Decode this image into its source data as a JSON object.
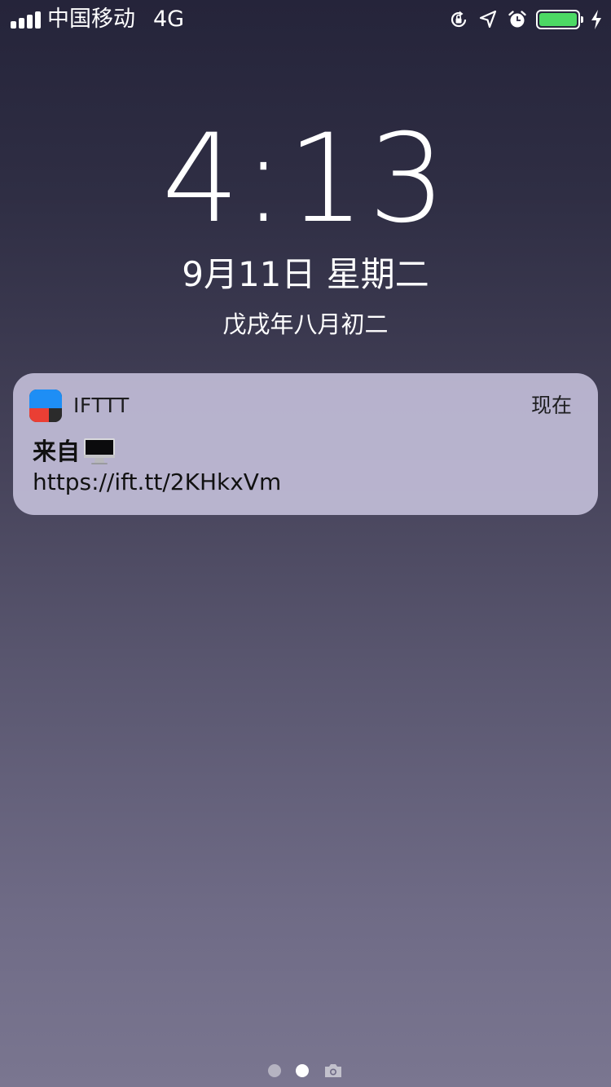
{
  "status_bar": {
    "carrier": "中国移动",
    "network": "4G",
    "battery_level": 1.0,
    "battery_color": "#4cd964",
    "icons": [
      "signal-icon",
      "orientation-lock-icon",
      "location-arrow-icon",
      "alarm-icon",
      "battery-icon",
      "charging-bolt-icon"
    ]
  },
  "lock_screen": {
    "time": "4:13",
    "date": "9月11日 星期二",
    "lunar_date": "戊戌年八月初二"
  },
  "notification": {
    "app_name": "IFTTT",
    "time": "现在",
    "title": "来自",
    "title_icon": "desktop-computer-icon",
    "body": "https://ift.tt/2KHkxVm"
  },
  "page_indicator": {
    "pages": 2,
    "active_index": 1,
    "trailing_icon": "camera-icon"
  }
}
